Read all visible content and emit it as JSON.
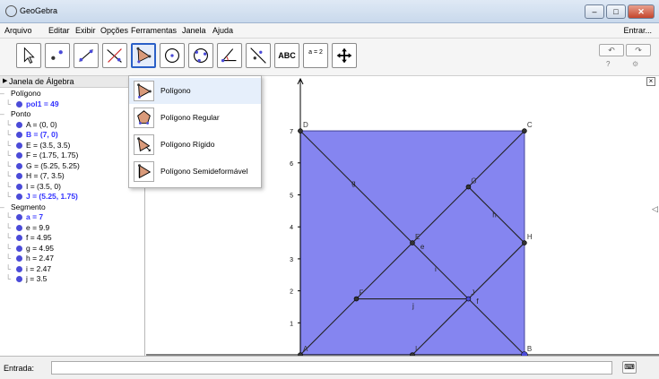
{
  "window": {
    "title": "GeoGebra",
    "minimize": "–",
    "maximize": "□",
    "close": "✕"
  },
  "menu": {
    "items": [
      "Arquivo",
      "Editar",
      "Exibir",
      "Opções",
      "Ferramentas",
      "Janela",
      "Ajuda"
    ],
    "login": "Entrar..."
  },
  "toolbar": {
    "tools": [
      "move-tool-icon",
      "point-tool-icon",
      "line-tool-icon",
      "perpendicular-tool-icon",
      "polygon-tool-icon",
      "circle-tool-icon",
      "circle-three-points-tool-icon",
      "angle-tool-icon",
      "reflect-tool-icon",
      "text-tool-icon",
      "slider-tool-icon",
      "move-view-tool-icon"
    ],
    "text_tool_label": "ABC",
    "slider_tool_label": "a = 2",
    "undo": "↶",
    "redo": "↷",
    "help": "?",
    "settings": "⚙"
  },
  "polygon_menu": {
    "items": [
      "Polígono",
      "Polígono Regular",
      "Polígono Rígido",
      "Polígono Semideformável"
    ]
  },
  "algebra": {
    "title": "Janela de Álgebra",
    "groups": [
      {
        "name": "Polígono",
        "items": [
          {
            "text": "pol1 = 49",
            "color": "#3333ff"
          }
        ]
      },
      {
        "name": "Ponto",
        "items": [
          {
            "text": "A = (0, 0)",
            "color": "#000000"
          },
          {
            "text": "B = (7, 0)",
            "color": "#3333ff"
          },
          {
            "text": "E = (3.5, 3.5)",
            "color": "#000000"
          },
          {
            "text": "F = (1.75, 1.75)",
            "color": "#000000"
          },
          {
            "text": "G = (5.25, 5.25)",
            "color": "#000000"
          },
          {
            "text": "H = (7, 3.5)",
            "color": "#000000"
          },
          {
            "text": "I = (3.5, 0)",
            "color": "#000000"
          },
          {
            "text": "J = (5.25, 1.75)",
            "color": "#3333ff"
          }
        ]
      },
      {
        "name": "Segmento",
        "items": [
          {
            "text": "a = 7",
            "color": "#3333ff"
          },
          {
            "text": "e = 9.9",
            "color": "#000000"
          },
          {
            "text": "f = 4.95",
            "color": "#000000"
          },
          {
            "text": "g = 4.95",
            "color": "#000000"
          },
          {
            "text": "h = 2.47",
            "color": "#000000"
          },
          {
            "text": "i = 2.47",
            "color": "#000000"
          },
          {
            "text": "j = 3.5",
            "color": "#000000"
          }
        ]
      }
    ]
  },
  "graphics": {
    "y_ticks": [
      "1",
      "2",
      "3",
      "4",
      "5",
      "6",
      "7"
    ],
    "polygon_fill": "#8585f0",
    "points": [
      {
        "label": "A",
        "x": 0,
        "y": 0
      },
      {
        "label": "B",
        "x": 7,
        "y": 0
      },
      {
        "label": "C",
        "x": 7,
        "y": 7
      },
      {
        "label": "D",
        "x": 0,
        "y": 7
      },
      {
        "label": "E",
        "x": 3.5,
        "y": 3.5
      },
      {
        "label": "F",
        "x": 1.75,
        "y": 1.75
      },
      {
        "label": "G",
        "x": 5.25,
        "y": 5.25
      },
      {
        "label": "H",
        "x": 7,
        "y": 3.5
      },
      {
        "label": "I",
        "x": 3.5,
        "y": 0
      },
      {
        "label": "J",
        "x": 5.25,
        "y": 1.75
      }
    ],
    "segments": [
      {
        "from": "A",
        "to": "C"
      },
      {
        "from": "D",
        "to": "B"
      },
      {
        "from": "F",
        "to": "J"
      },
      {
        "from": "G",
        "to": "H"
      },
      {
        "from": "I",
        "to": "H"
      }
    ],
    "segment_labels": [
      {
        "text": "g",
        "x": 1.6,
        "y": 5.3
      },
      {
        "text": "h",
        "x": 6.0,
        "y": 4.3
      },
      {
        "text": "e",
        "x": 3.75,
        "y": 3.3
      },
      {
        "text": "i",
        "x": 4.2,
        "y": 2.6
      },
      {
        "text": "j",
        "x": 3.5,
        "y": 1.45
      },
      {
        "text": "f",
        "x": 5.5,
        "y": 1.6
      }
    ]
  },
  "input": {
    "label": "Entrada:",
    "value": "",
    "keyboard": "⌨"
  }
}
